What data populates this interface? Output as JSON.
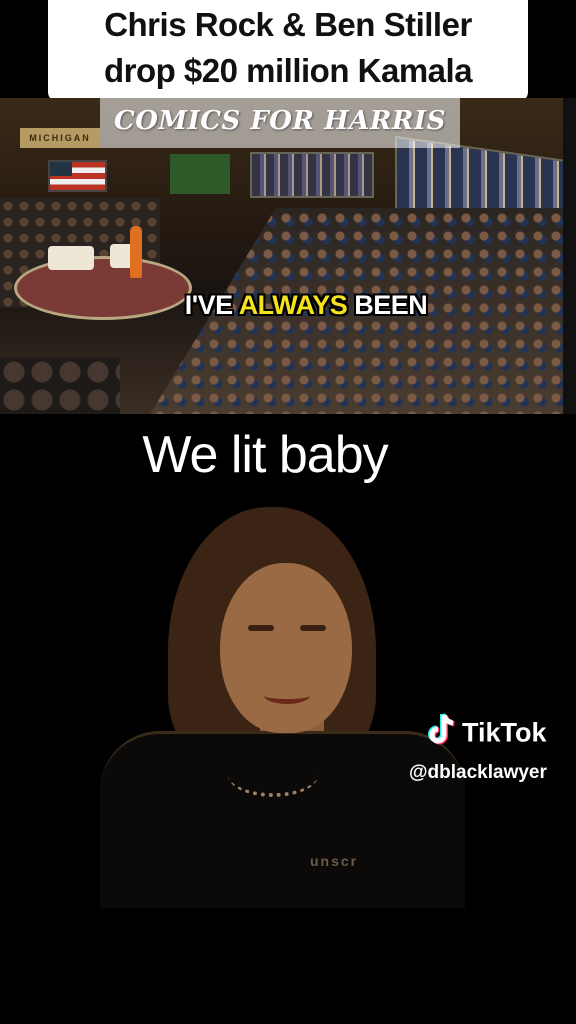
{
  "headline": {
    "line1": "Chris Rock & Ben Stiller",
    "line2": "drop $20 million Kamala"
  },
  "video": {
    "overlay_label": "COMICS FOR HARRIS",
    "stage_banner": "MICHIGAN",
    "caption": {
      "word1": "I'VE",
      "word2": "ALWAYS",
      "word3": "BEEN"
    },
    "colors": {
      "caption_white": "#ffffff",
      "caption_highlight": "#f4e21a"
    }
  },
  "meme_text": "We lit baby",
  "sticker": {
    "pin_text": "unscr"
  },
  "watermark": {
    "brand": "TikTok",
    "handle": "@dblacklawyer",
    "icon": "tiktok-logo-icon"
  }
}
